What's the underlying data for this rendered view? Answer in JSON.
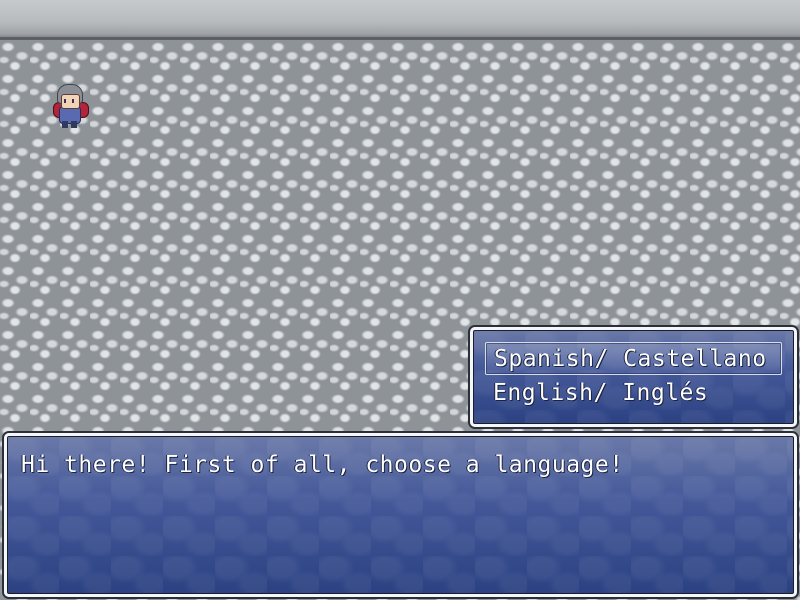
{
  "map": {
    "sprite_icon": "hero-sprite-icon"
  },
  "choice_window": {
    "options": [
      {
        "label": "Spanish/ Castellano",
        "selected": true
      },
      {
        "label": "English/ Inglés",
        "selected": false
      }
    ]
  },
  "message_window": {
    "text": "Hi there! First of all, choose a language!"
  },
  "colors": {
    "window_top": "#6a79a8",
    "window_bottom": "#2b4182",
    "window_border": "#f4f6fa",
    "text": "#ffffff"
  }
}
